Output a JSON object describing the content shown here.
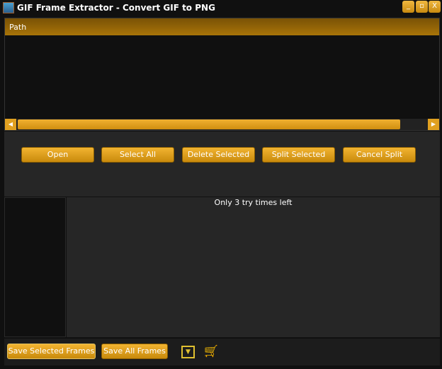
{
  "window": {
    "title": "GIF Frame Extractor - Convert GIF to PNG",
    "minimize": "_",
    "maximize": "▫",
    "close": "X"
  },
  "list": {
    "column_path": "Path",
    "scroll_left": "◀",
    "scroll_right": "▶"
  },
  "toolbar": {
    "open": "Open",
    "select_all": "Select All",
    "delete_selected": "Delete Selected",
    "split_selected": "Split Selected",
    "cancel_split": "Cancel Split"
  },
  "status": {
    "message": "Only 3 try times left"
  },
  "footer": {
    "save_selected": "Save Selected Frames",
    "save_all": "Save All Frames",
    "dropdown": "▼",
    "cart": "🛒"
  }
}
